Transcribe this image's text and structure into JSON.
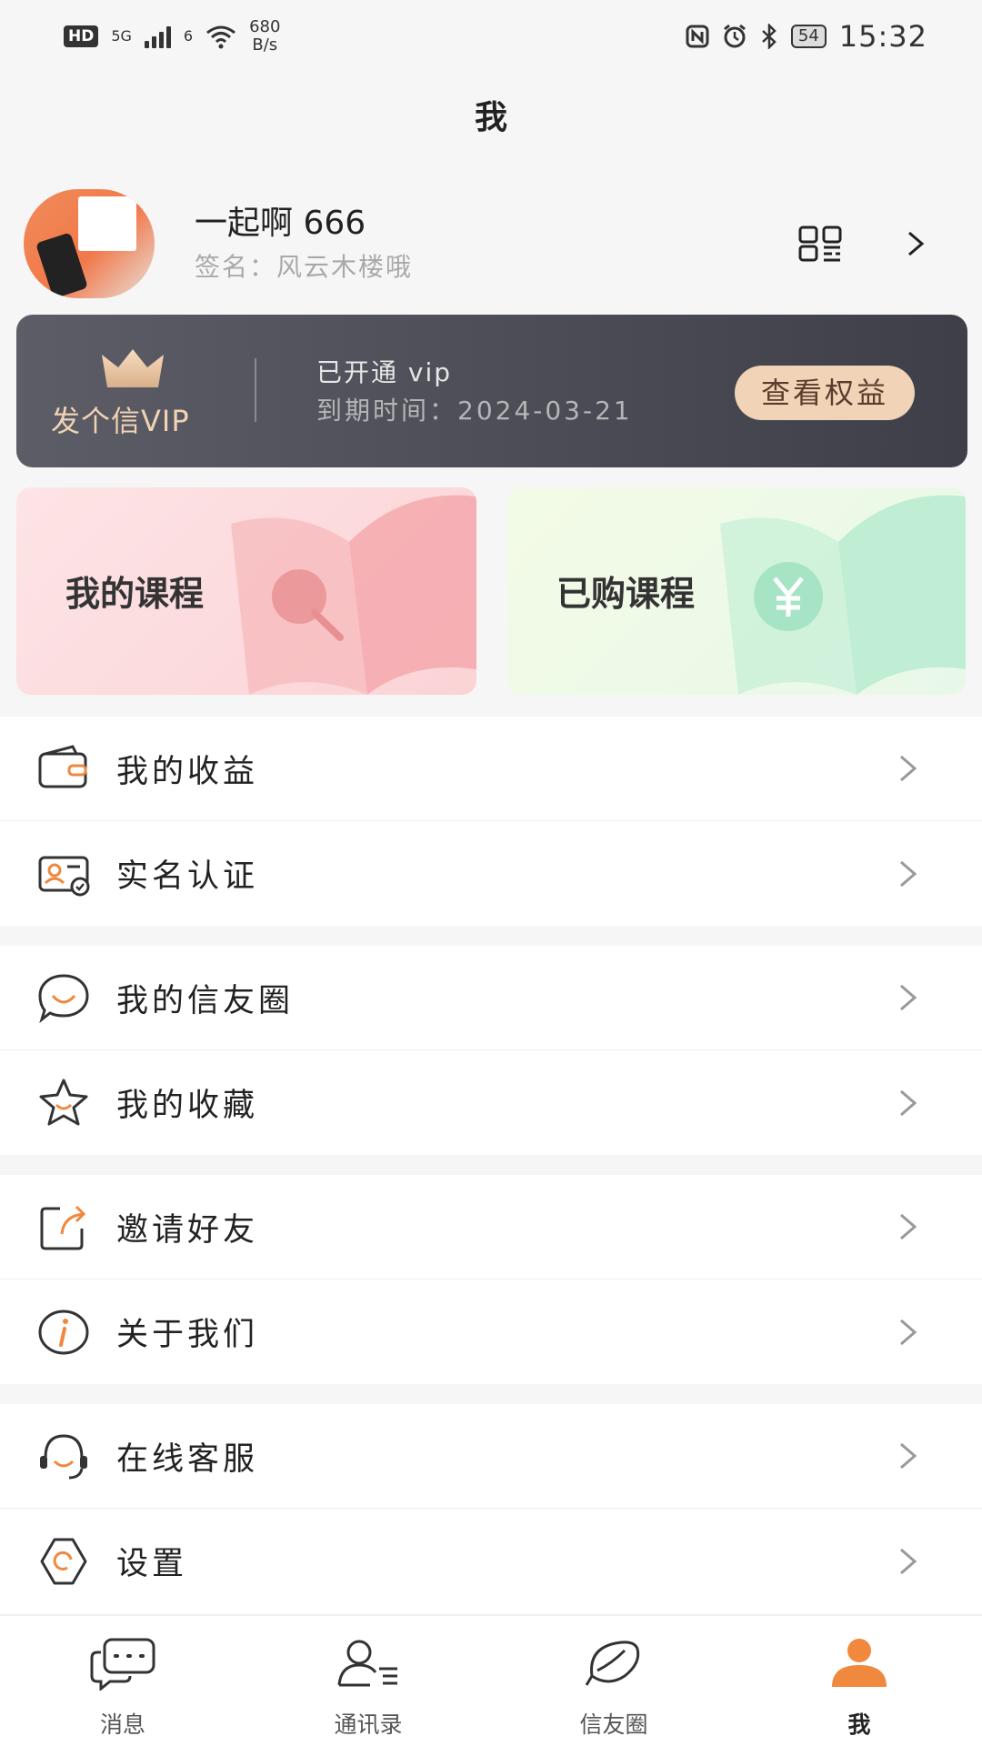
{
  "status_bar": {
    "hd": "HD",
    "network": "5G",
    "wifi_gen": "6",
    "speed_value": "680",
    "speed_unit": "B/s",
    "battery": "54",
    "time": "15:32"
  },
  "page": {
    "title": "我"
  },
  "profile": {
    "name": "一起啊 666",
    "signature": "签名：风云木楼哦"
  },
  "vip": {
    "brand": "发个信VIP",
    "status": "已开通 vip",
    "expire": "到期时间：2024-03-21",
    "button": "查看权益"
  },
  "cards": {
    "my_courses": "我的课程",
    "purchased_courses": "已购课程"
  },
  "menu": {
    "earnings": "我的收益",
    "verification": "实名认证",
    "moments": "我的信友圈",
    "favorites": "我的收藏",
    "invite": "邀请好友",
    "about": "关于我们",
    "support": "在线客服",
    "settings": "设置"
  },
  "tabs": {
    "messages": "消息",
    "contacts": "通讯录",
    "moments": "信友圈",
    "me": "我"
  },
  "colors": {
    "accent": "#f0883e",
    "vip_gold": "#f1d3b3",
    "vip_bg": "#4a4b54"
  }
}
